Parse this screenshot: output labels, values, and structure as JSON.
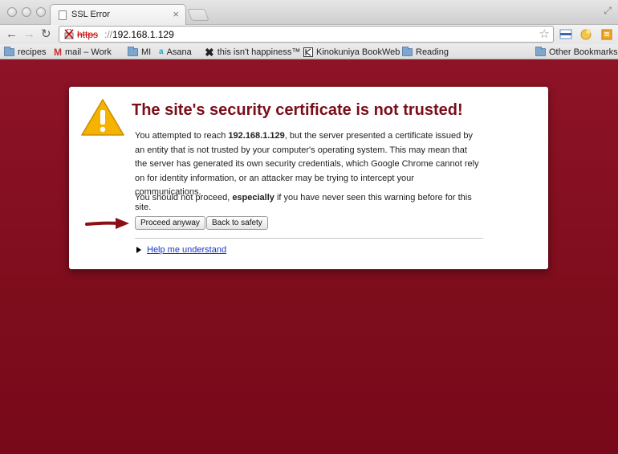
{
  "browser": {
    "tab_title": "SSL Error",
    "tab_close": "×",
    "url_scheme": "https",
    "url_separator": "://",
    "url_host": "192.168.1.129"
  },
  "bookmarks": [
    {
      "label": "recipes",
      "icon": "folder-icon"
    },
    {
      "label": "mail – Work",
      "icon": "gmail-icon"
    },
    {
      "label": "MI",
      "icon": "folder-icon"
    },
    {
      "label": "Asana",
      "icon": "asana-icon"
    },
    {
      "label": "this isn't happiness™",
      "icon": "x-icon"
    },
    {
      "label": "Kinokuniya BookWeb",
      "icon": "kinokuniya-icon"
    },
    {
      "label": "Reading",
      "icon": "folder-icon"
    },
    {
      "label": "Other Bookmarks",
      "icon": "folder-icon"
    }
  ],
  "interstitial": {
    "heading": "The site's security certificate is not trusted!",
    "para1_before": "You attempted to reach ",
    "para1_host": "192.168.1.129",
    "para1_after": ", but the server presented a certificate issued by an entity that is not trusted by your computer's operating system. This may mean that the server has generated its own security credentials, which Google Chrome cannot rely on for identity information, or an attacker may be trying to intercept your communications.",
    "para2_before": "You should not proceed, ",
    "para2_bold": "especially",
    "para2_after": " if you have never seen this warning before for this site.",
    "proceed_label": "Proceed anyway",
    "back_label": "Back to safety",
    "help_label": "Help me understand"
  },
  "colors": {
    "background": "#7d0d1c",
    "heading": "#7a0e19",
    "link": "#1a35c9",
    "url_error": "#c50000"
  }
}
